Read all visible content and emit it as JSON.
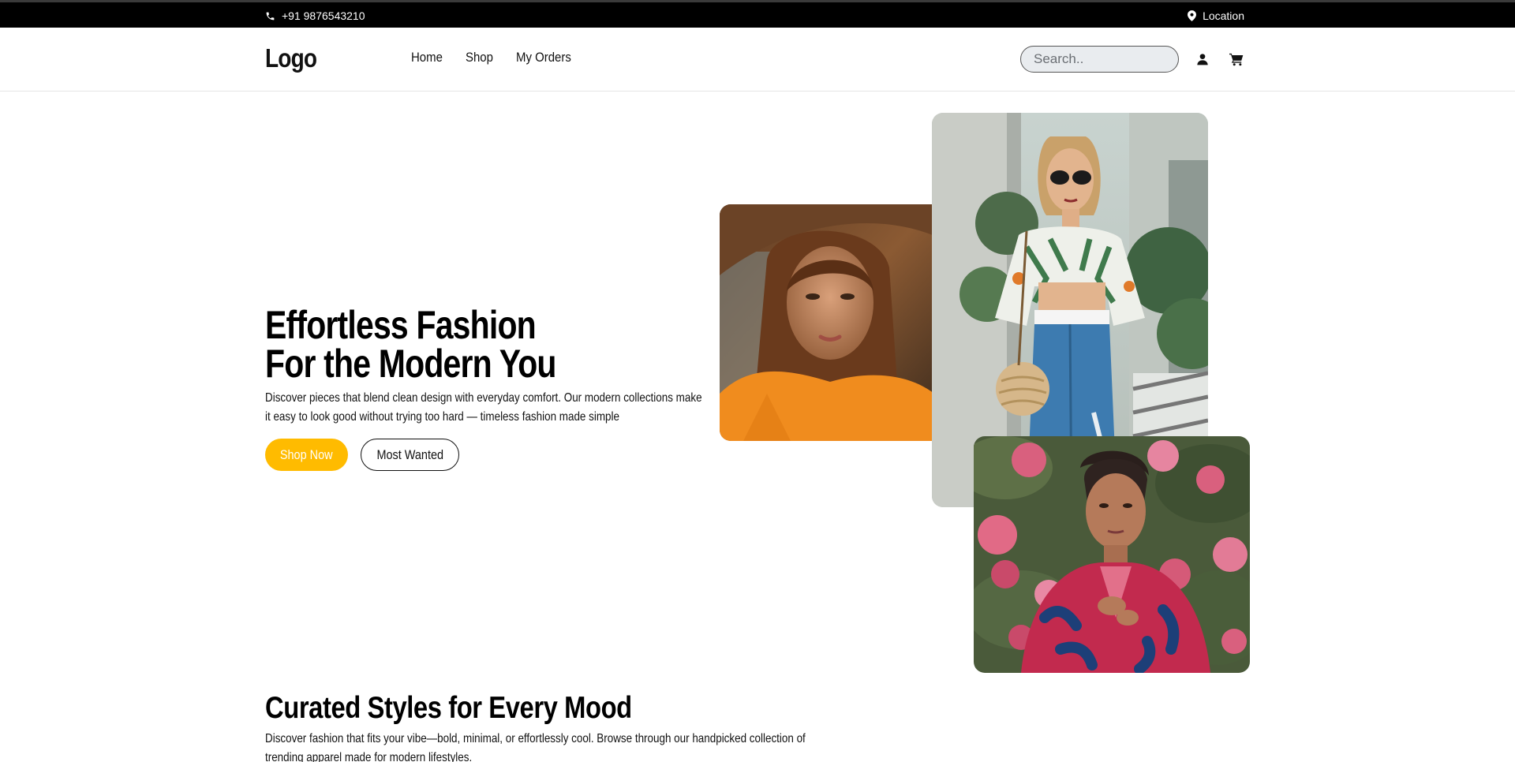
{
  "topbar": {
    "phone": "+91 9876543210",
    "location": "Location",
    "phone_icon": "phone-icon",
    "location_icon": "map-pin-icon"
  },
  "header": {
    "logo": "Logo",
    "nav": [
      {
        "label": "Home"
      },
      {
        "label": "Shop"
      },
      {
        "label": "My Orders"
      }
    ],
    "search_placeholder": "Search..",
    "user_icon": "user-icon",
    "cart_icon": "cart-icon"
  },
  "hero": {
    "title_line1": "Effortless Fashion",
    "title_line2": "For the Modern You",
    "description": "Discover pieces that blend clean design with everyday comfort. Our modern collections make it easy to look good without trying too hard — timeless fashion made simple",
    "primary_button": "Shop Now",
    "secondary_button": "Most Wanted",
    "accent_color": "#ffbb00"
  },
  "section": {
    "title": "Curated Styles for Every Mood",
    "description": "Discover fashion that fits your vibe—bold, minimal, or effortlessly cool. Browse through our handpicked collection of trending apparel made for modern lifestyles."
  }
}
